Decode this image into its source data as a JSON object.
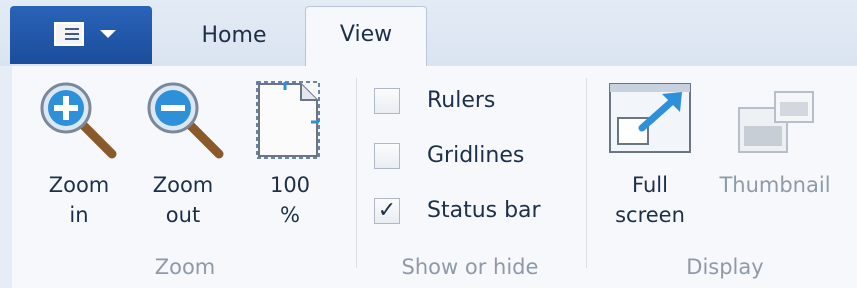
{
  "tabs": [
    {
      "label": "Home",
      "active": false
    },
    {
      "label": "View",
      "active": true
    }
  ],
  "app_menu": {
    "icon": "document-menu-icon"
  },
  "groups": {
    "zoom": {
      "label": "Zoom",
      "zoom_in": "Zoom\nin",
      "zoom_out": "Zoom\nout",
      "actual_size": "100\n%"
    },
    "show_or_hide": {
      "label": "Show or hide",
      "rulers": {
        "label": "Rulers",
        "checked": false
      },
      "gridlines": {
        "label": "Gridlines",
        "checked": false
      },
      "status_bar": {
        "label": "Status bar",
        "checked": true
      }
    },
    "display": {
      "label": "Display",
      "full_screen": "Full\nscreen",
      "thumbnail": "Thumbnail"
    }
  },
  "colors": {
    "accent": "#1b4d9c",
    "icon_blue": "#2e90d8",
    "disabled_text": "#8f9aa8"
  }
}
